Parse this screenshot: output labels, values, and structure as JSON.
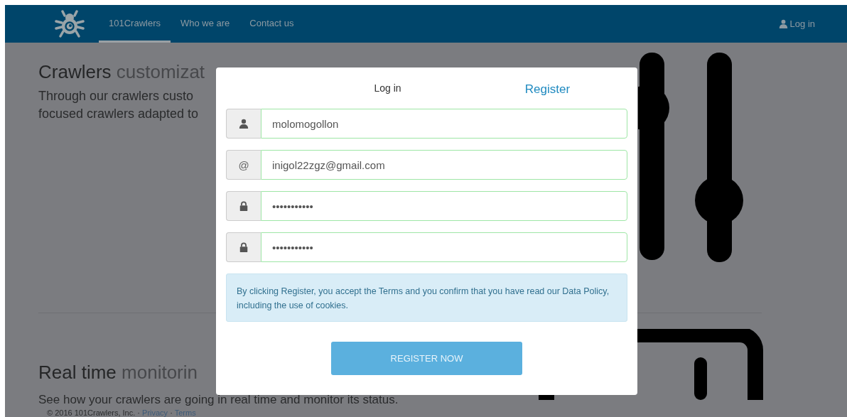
{
  "navbar": {
    "links": [
      {
        "label": "101Crawlers",
        "selected": true
      },
      {
        "label": "Who we are",
        "selected": false
      },
      {
        "label": "Contact us",
        "selected": false
      }
    ],
    "login": {
      "label": "Log in"
    }
  },
  "sections": [
    {
      "title": "Crawlers",
      "title_light": "customizat",
      "lines": [
        "Through our crawlers custo",
        "focused crawlers adapted to"
      ],
      "kind": "sliders"
    },
    {
      "title": "Real time",
      "title_light": "monitorin",
      "lines": [
        "See how your crawlers are going in real time and monitor its status."
      ],
      "kind": "screen"
    }
  ],
  "footer": {
    "text": "© 2016 101Crawlers, Inc. ·",
    "links": [
      "Privacy",
      "Terms"
    ],
    "separator": "·"
  },
  "modal": {
    "tabs": [
      {
        "label": "Log in",
        "selected": false
      },
      {
        "label": "Register",
        "selected": true
      }
    ],
    "fields": [
      {
        "kind": "user",
        "value": "molomogollon",
        "valid": true
      },
      {
        "kind": "email",
        "addon_text": "@",
        "value": "inigol22zgz@gmail.com",
        "valid": true
      },
      {
        "kind": "password",
        "value": "•••••••••••",
        "valid": true
      },
      {
        "kind": "password",
        "value": "•••••••••••",
        "valid": true
      }
    ],
    "notice": "By clicking Register, you accept the Terms and you confirm that you have read our Data Policy, including the use of cookies.",
    "submit": "REGISTER NOW"
  }
}
